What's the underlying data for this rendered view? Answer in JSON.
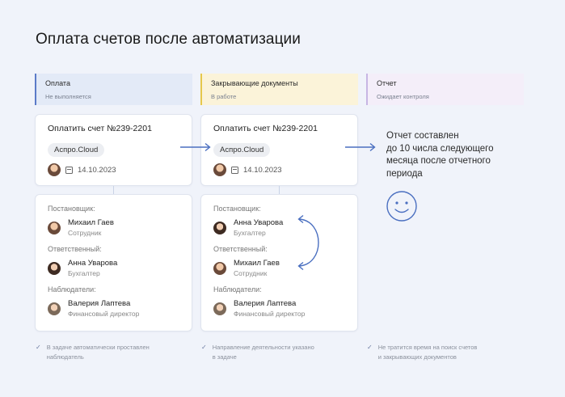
{
  "title": "Оплата счетов после автоматизации",
  "stages": [
    {
      "title": "Оплата",
      "status": "Не выполняется",
      "color": "#5b7bc8",
      "bg": "#e3eaf7"
    },
    {
      "title": "Закрывающие документы",
      "status": "В работе",
      "color": "#e6c84a",
      "bg": "#fbf3d9"
    },
    {
      "title": "Отчет",
      "status": "Ожидает контроля",
      "color": "#c7b6e3",
      "bg": "#f4eef9"
    }
  ],
  "tasks": [
    {
      "title": "Оплатить счет №239-2201",
      "tag": "Аспро.Cloud",
      "date": "14.10.2023"
    },
    {
      "title": "Оплатить счет №239-2201",
      "tag": "Аспро.Cloud",
      "date": "14.10.2023"
    }
  ],
  "people_cards": [
    {
      "director_label": "Постановщик:",
      "director": {
        "name": "Михаил Гаев",
        "position": "Сотрудник"
      },
      "responsible_label": "Ответственный:",
      "responsible": {
        "name": "Анна Уварова",
        "position": "Бухгалтер"
      },
      "observers_label": "Наблюдатели:",
      "observer": {
        "name": "Валерия Лаптева",
        "position": "Финансовый директор"
      }
    },
    {
      "director_label": "Постановщик:",
      "director": {
        "name": "Анна Уварова",
        "position": "Бухгалтер"
      },
      "responsible_label": "Ответственный:",
      "responsible": {
        "name": "Михаил Гаев",
        "position": "Сотрудник"
      },
      "observers_label": "Наблюдатели:",
      "observer": {
        "name": "Валерия Лаптева",
        "position": "Финансовый директор"
      }
    }
  ],
  "report_text": "Отчет составлен до 10 числа следующего месяца после отчетного периода",
  "report_lines": [
    "Отчет составлен",
    "до 10 числа следующего",
    "месяца после отчетного",
    "периода"
  ],
  "notes": [
    {
      "line1": "В задаче автоматически проставлен",
      "line2": "наблюдатель"
    },
    {
      "line1": "Направление деятельности указано",
      "line2": "в задаче"
    },
    {
      "line1": "Не тратится время на поиск счетов",
      "line2": "и закрывающих документов"
    }
  ],
  "icons": {
    "check": "check-icon",
    "arrow": "arrow-right-icon",
    "swap": "swap-arrows-icon",
    "smile": "smile-icon",
    "calendar": "calendar-icon"
  },
  "accent_color": "#4a6fc0"
}
